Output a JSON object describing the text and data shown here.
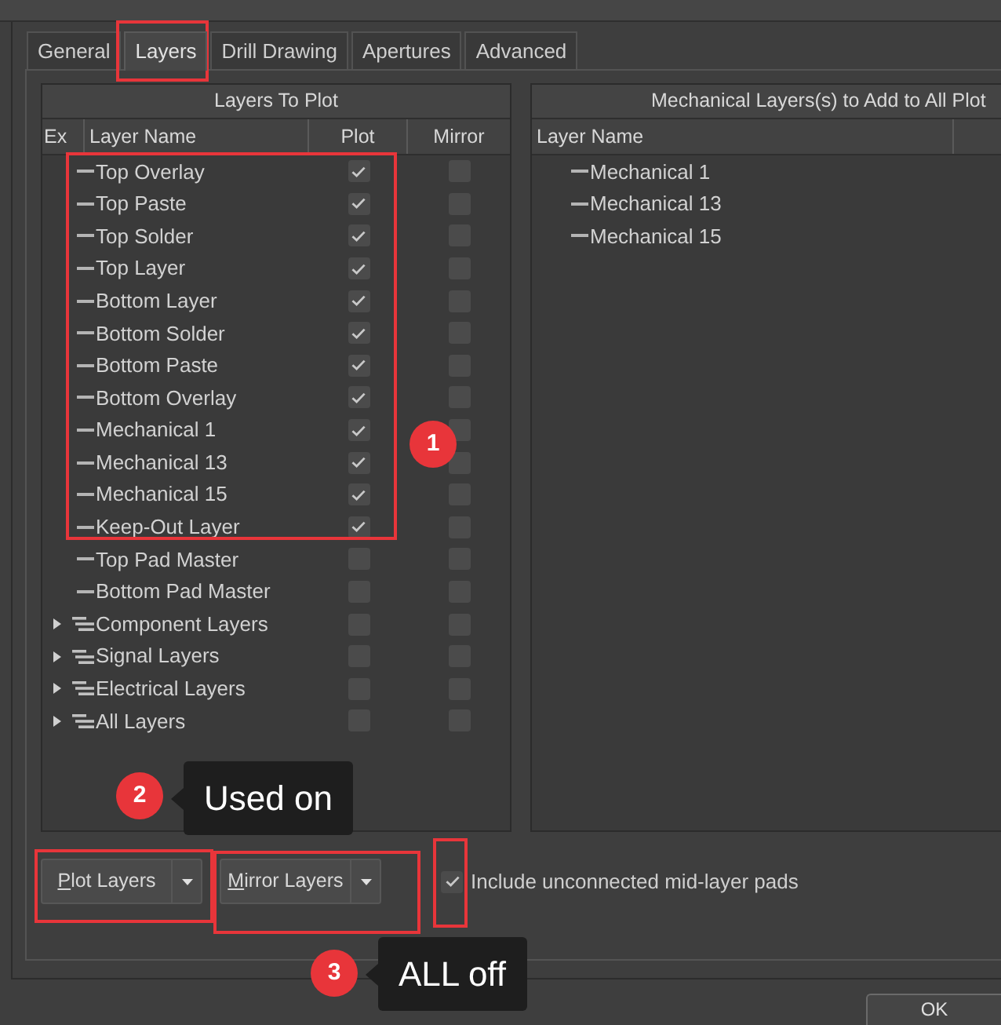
{
  "tabs": [
    {
      "label": "General",
      "selected": false
    },
    {
      "label": "Layers",
      "selected": true
    },
    {
      "label": "Drill Drawing",
      "selected": false
    },
    {
      "label": "Apertures",
      "selected": false
    },
    {
      "label": "Advanced",
      "selected": false
    }
  ],
  "layers_to_plot": {
    "title": "Layers To Plot",
    "columns": [
      "Ex",
      "Layer Name",
      "Plot",
      "Mirror"
    ],
    "rows": [
      {
        "kind": "layer",
        "name": "Top Overlay",
        "plot": true,
        "mirror": false
      },
      {
        "kind": "layer",
        "name": "Top Paste",
        "plot": true,
        "mirror": false
      },
      {
        "kind": "layer",
        "name": "Top Solder",
        "plot": true,
        "mirror": false
      },
      {
        "kind": "layer",
        "name": "Top Layer",
        "plot": true,
        "mirror": false
      },
      {
        "kind": "layer",
        "name": "Bottom Layer",
        "plot": true,
        "mirror": false
      },
      {
        "kind": "layer",
        "name": "Bottom Solder",
        "plot": true,
        "mirror": false
      },
      {
        "kind": "layer",
        "name": "Bottom Paste",
        "plot": true,
        "mirror": false
      },
      {
        "kind": "layer",
        "name": "Bottom Overlay",
        "plot": true,
        "mirror": false
      },
      {
        "kind": "layer",
        "name": "Mechanical 1",
        "plot": true,
        "mirror": false
      },
      {
        "kind": "layer",
        "name": "Mechanical 13",
        "plot": true,
        "mirror": false
      },
      {
        "kind": "layer",
        "name": "Mechanical 15",
        "plot": true,
        "mirror": false
      },
      {
        "kind": "layer",
        "name": "Keep-Out Layer",
        "plot": true,
        "mirror": false
      },
      {
        "kind": "layer",
        "name": "Top Pad Master",
        "plot": false,
        "mirror": false
      },
      {
        "kind": "layer",
        "name": "Bottom Pad Master",
        "plot": false,
        "mirror": false
      },
      {
        "kind": "group",
        "name": "Component Layers",
        "expanded": false,
        "plot": false,
        "mirror": false
      },
      {
        "kind": "group",
        "name": "Signal Layers",
        "expanded": false,
        "plot": false,
        "mirror": false
      },
      {
        "kind": "group",
        "name": "Electrical Layers",
        "expanded": false,
        "plot": false,
        "mirror": false
      },
      {
        "kind": "group",
        "name": "All Layers",
        "expanded": false,
        "plot": false,
        "mirror": false
      }
    ]
  },
  "mechanical_layers": {
    "title": "Mechanical Layers(s) to Add to All Plot",
    "columns": [
      "Layer Name"
    ],
    "rows": [
      {
        "name": "Mechanical 1"
      },
      {
        "name": "Mechanical 13"
      },
      {
        "name": "Mechanical 15"
      }
    ]
  },
  "buttons": [
    {
      "label": "Plot Layers",
      "mnemonic_first_letter": true
    },
    {
      "label": "Mirror Layers",
      "mnemonic_first_letter": true
    }
  ],
  "include_unconnected_pads": {
    "label": "Include unconnected mid-layer pads",
    "checked": true
  },
  "annotations": [
    {
      "number": "1"
    },
    {
      "number": "2",
      "note": "Used on"
    },
    {
      "number": "3",
      "note": "ALL off"
    }
  ],
  "ok_button": {
    "label": "OK"
  }
}
